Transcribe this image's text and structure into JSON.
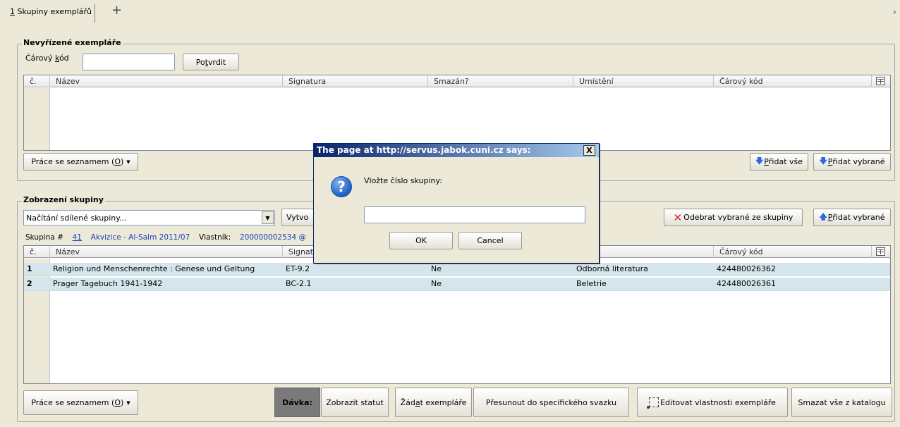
{
  "tabs": {
    "active_num": "1",
    "active_label": " Skupiny exemplářů",
    "add_symbol": "+",
    "close_symbol": "›"
  },
  "pending": {
    "legend": "Nevyřízené exempláře",
    "barcode_label_pre": "Čárový ",
    "barcode_label_ul": "k",
    "barcode_label_post": "ód",
    "barcode_value": "",
    "confirm_pre": "Po",
    "confirm_ul": "t",
    "confirm_post": "vrdit",
    "columns": [
      "č.",
      "Název",
      "Signatura",
      "Smazán?",
      "Umístění",
      "Čárový kód"
    ],
    "list_menu": "Práce se seznamem (O)",
    "list_menu_pre": "Práce se seznamem (",
    "list_menu_ul": "O",
    "list_menu_post": ")",
    "add_all_pre": "P",
    "add_all_post": "řidat vše",
    "add_selected_pre": "P",
    "add_selected_post": "řidat vybrané"
  },
  "group": {
    "legend": "Zobrazení skupiny",
    "select_value": "Načítání sdílené skupiny...",
    "create_btn": "Vytvo",
    "remove_selected": "Odebrat vybrané ze skupiny",
    "add_selected_pre": "P",
    "add_selected_post": "řidat vybrané",
    "info_prefix": "Skupina #",
    "group_number": "41",
    "group_name": "Akvizice - Al-Salm 2011/07",
    "owner_label": "Vlastník:",
    "owner_value": "200000002534 @",
    "columns": [
      "č.",
      "Název",
      "Signat",
      "",
      "šní",
      "Čárový kód"
    ],
    "rows": [
      {
        "num": "1",
        "title": "Religion und Menschenrechte : Genese und Geltung",
        "signature": "ET-9.2",
        "deleted": "Ne",
        "location": "Odborná literatura",
        "barcode": "424480026362"
      },
      {
        "num": "2",
        "title": "Prager Tagebuch 1941-1942",
        "signature": "BC-2.1",
        "deleted": "Ne",
        "location": "Beletrie",
        "barcode": "424480026361"
      }
    ],
    "list_menu_pre": "Práce se seznamem (",
    "list_menu_ul": "O",
    "list_menu_post": ")",
    "batch_label": "Dávka:",
    "show_status": "Zobrazit statut",
    "request_pre": "Žád",
    "request_ul": "a",
    "request_post": "t exempláře",
    "move_volume": "Přesunout do specifického svazku",
    "edit_props": "Editovat vlastnosti exempláře",
    "delete_all": "Smazat vše z katalogu"
  },
  "dialog": {
    "title": "The page at http://servus.jabok.cuni.cz says:",
    "close": "X",
    "message": "Vložte číslo skupiny:",
    "input_value": "",
    "ok": "OK",
    "cancel": "Cancel",
    "icon_glyph": "?"
  }
}
